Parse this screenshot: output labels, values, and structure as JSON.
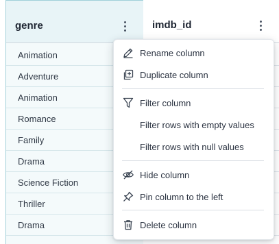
{
  "columns": [
    {
      "title": "genre",
      "selected": true
    },
    {
      "title": "imdb_id",
      "selected": false
    }
  ],
  "genre_rows": [
    "Animation",
    "Adventure",
    "Animation",
    "Romance",
    "Family",
    "Drama",
    "Science Fiction",
    "Thriller",
    "Drama"
  ],
  "imdb_rows": [
    "",
    "",
    "",
    "",
    "",
    "",
    "",
    "",
    ""
  ],
  "menu": {
    "rename": {
      "label": "Rename column",
      "icon": "pencil-icon"
    },
    "duplicate": {
      "label": "Duplicate column",
      "icon": "duplicate-icon"
    },
    "filter": {
      "label": "Filter column",
      "icon": "filter-icon"
    },
    "filter_empty": {
      "label": "Filter rows with empty values"
    },
    "filter_null": {
      "label": "Filter rows with null values"
    },
    "hide": {
      "label": "Hide column",
      "icon": "eye-off-icon"
    },
    "pin": {
      "label": "Pin column to the left",
      "icon": "pin-icon"
    },
    "delete": {
      "label": "Delete column",
      "icon": "trash-icon"
    }
  },
  "colors": {
    "selected_column_bg": "#f4fafb",
    "selected_header_bg": "#e8f4f7",
    "selected_border": "#6fbac8"
  }
}
